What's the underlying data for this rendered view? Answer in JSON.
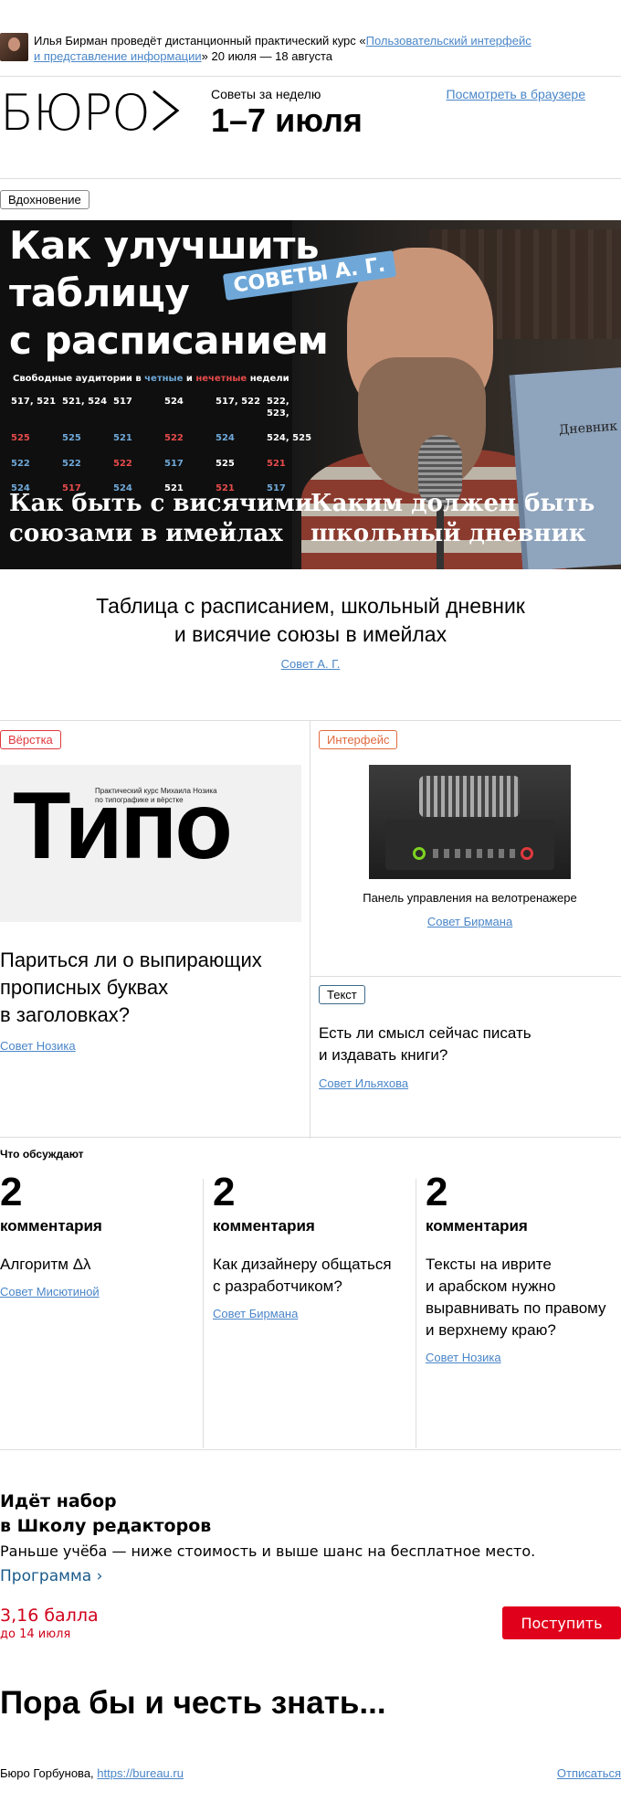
{
  "announce": {
    "prefix": "Илья Бирман проведёт дистанционный практический курс «",
    "course_link_1": "Пользовательский интерфейс",
    "course_link_2": "и представление информации",
    "suffix": "» 20 июля — 18 августа"
  },
  "header": {
    "logo": "БЮРО",
    "subtitle": "Советы за неделю",
    "date": "1–7 июля",
    "browser_link": "Посмотреть в браузере"
  },
  "hero": {
    "tag": "Вдохновение",
    "title_lines": [
      "Как улучшить",
      "таблицу",
      "с расписанием"
    ],
    "badge": "СОВЕТЫ А. Г.",
    "table_caption_a": "Свободные аудитории в ",
    "table_caption_b": "четные",
    "table_caption_c": " и ",
    "table_caption_d": "нечетные",
    "table_caption_e": " недели",
    "grid": [
      [
        "517, 521",
        "521, 524",
        "517",
        "524",
        "517, 522",
        "522, 523,"
      ],
      [
        "525",
        "525",
        "521",
        "522",
        "524",
        "524, 525"
      ],
      [
        "522",
        "522",
        "522",
        "517",
        "525",
        "521"
      ],
      [
        "524",
        "517",
        "524",
        "521",
        "521",
        "517"
      ]
    ],
    "book_label": "Дневник",
    "foot_left": [
      "Как быть с висячими",
      "союзами в имейлах"
    ],
    "foot_right": [
      "Каким должен быть",
      "школьный дневник"
    ]
  },
  "lead": {
    "line1": "Таблица с расписанием, школьный дневник",
    "line2": "и висячие союзы в имейлах",
    "link": "Совет А. Г."
  },
  "col1": {
    "tag": "Вёрстка",
    "image_word": "Типо",
    "image_note_1": "Практический курс Михаила Нозика",
    "image_note_2": "по типографике и вёрстке",
    "title_lines": [
      "Париться ли о выпирающих",
      "прописных буквах",
      "в заголовках?"
    ],
    "link": "Совет Нозика"
  },
  "col2": {
    "tag": "Интерфейс",
    "caption": "Панель управления на велотренажере",
    "link": "Совет Бирмана"
  },
  "col3": {
    "tag": "Текст",
    "title_lines": [
      "Есть ли смысл сейчас писать",
      "и издавать книги?"
    ],
    "link": "Совет Ильяхова"
  },
  "discussed": {
    "heading": "Что обсуждают",
    "items": [
      {
        "count": "2",
        "label": "комментария",
        "title_lines": [
          "Алгоритм Δλ"
        ],
        "link": "Совет Мисютиной"
      },
      {
        "count": "2",
        "label": "комментария",
        "title_lines": [
          "Как дизайнеру общаться",
          "с разработчиком?"
        ],
        "link": "Совет Бирмана"
      },
      {
        "count": "2",
        "label": "комментария",
        "title_lines": [
          "Тексты на иврите",
          "и арабском нужно",
          "выравнивать по правому",
          "и верхнему краю?"
        ],
        "link": "Совет Нозика"
      }
    ]
  },
  "school": {
    "heading_1": "Идёт набор",
    "heading_2": "в Школу редакторов",
    "sub": "Раньше учёба — ниже стоимость и выше шанс на бесплатное место.",
    "program": "Программа ›",
    "score": "3,16 балла",
    "until": "до 14 июля",
    "apply": "Поступить"
  },
  "outro": "Пора бы и честь знать...",
  "footer": {
    "left_text": "Бюро Горбунова, ",
    "site": "https://bureau.ru",
    "unsubscribe": "Отписаться"
  }
}
